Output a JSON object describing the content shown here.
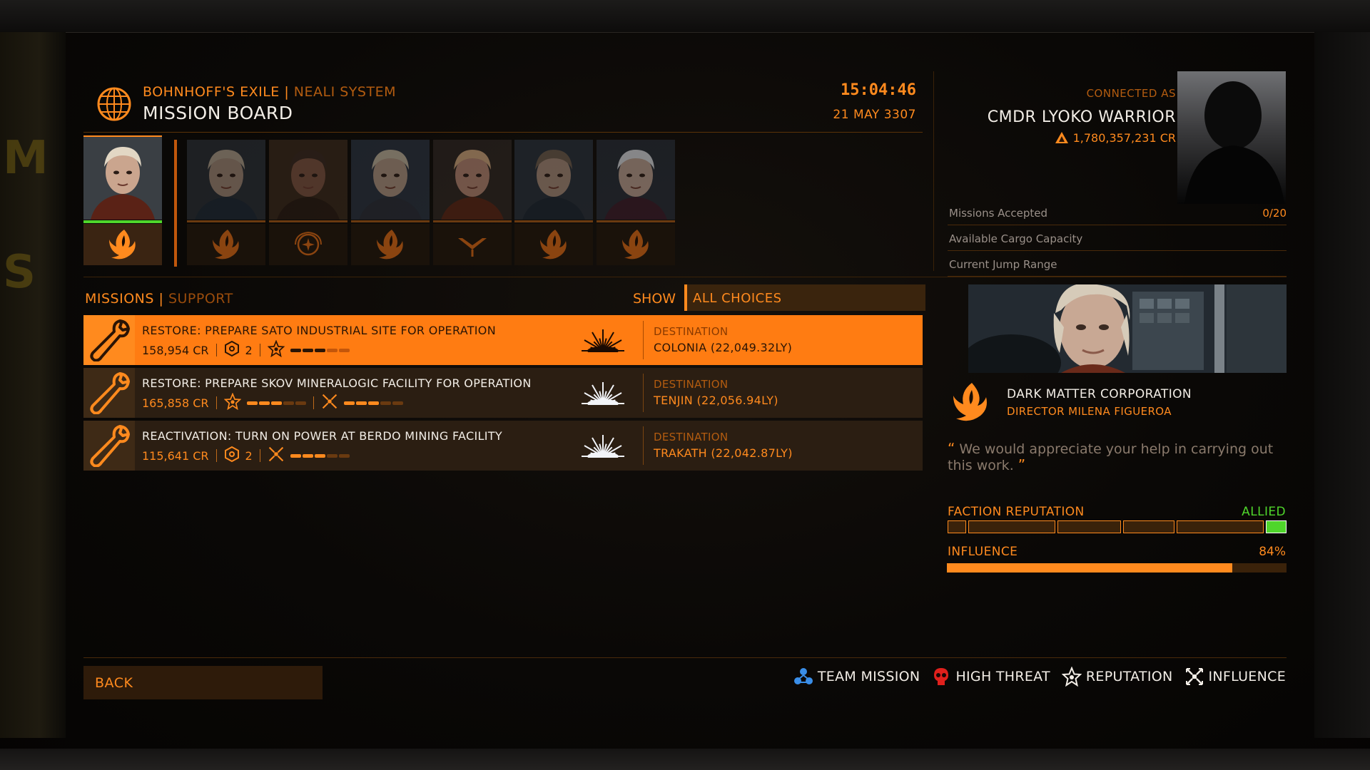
{
  "header": {
    "station": "BOHNHOFF'S EXILE",
    "divider": "|",
    "system": "NEALI SYSTEM",
    "title": "MISSION BOARD",
    "time": "15:04:46",
    "date": "21 MAY 3307"
  },
  "commander": {
    "connected_label": "CONNECTED AS",
    "name": "CMDR LYOKO WARRIOR",
    "credits": "1,780,357,231 CR",
    "stats": [
      {
        "label": "Missions Accepted",
        "value": "0/20"
      },
      {
        "label": "Available Cargo Capacity",
        "value": ""
      },
      {
        "label": "Current Jump Range",
        "value": ""
      }
    ]
  },
  "portraits": [
    {
      "emblem": "faction-wing-icon",
      "active": true
    },
    {
      "emblem": "faction-wing-icon"
    },
    {
      "emblem": "federation-icon"
    },
    {
      "emblem": "faction-wing-icon"
    },
    {
      "emblem": "alliance-icon"
    },
    {
      "emblem": "faction-wing-icon"
    },
    {
      "emblem": "faction-wing-icon"
    }
  ],
  "missions_header": {
    "tab_missions": "MISSIONS",
    "divider": "|",
    "tab_support": "SUPPORT",
    "show_label": "SHOW",
    "filter_value": "ALL CHOICES"
  },
  "missions": [
    {
      "title": "RESTORE: PREPARE SATO INDUSTRIAL SITE FOR OPERATION",
      "reward": "158,954 CR",
      "team_count": "2",
      "reputation_level": 3,
      "influence_level": 0,
      "destination_label": "DESTINATION",
      "destination": "COLONIA (22,049.32LY)",
      "selected": true
    },
    {
      "title": "RESTORE: PREPARE SKOV MINERALOGIC FACILITY FOR OPERATION",
      "reward": "165,858 CR",
      "team_count": "",
      "reputation_level": 3,
      "influence_level": 3,
      "destination_label": "DESTINATION",
      "destination": "TENJIN (22,056.94LY)",
      "selected": false
    },
    {
      "title": "REACTIVATION: TURN ON POWER AT BERDO MINING FACILITY",
      "reward": "115,641 CR",
      "team_count": "2",
      "reputation_level": 0,
      "influence_level": 3,
      "destination_label": "DESTINATION",
      "destination": "TRAKATH (22,042.87LY)",
      "selected": false
    }
  ],
  "contact": {
    "faction": "DARK MATTER CORPORATION",
    "director": "DIRECTOR MILENA FIGUEROA",
    "quote": "We would appreciate your help in carrying out this work.",
    "reputation_label": "FACTION REPUTATION",
    "reputation_value": "ALLIED",
    "reputation_level": 6,
    "influence_label": "INFLUENCE",
    "influence_value": "84%",
    "influence_fraction": 0.84
  },
  "footer": {
    "back_label": "BACK",
    "legend": [
      {
        "icon": "team-mission-icon",
        "label": "TEAM MISSION"
      },
      {
        "icon": "high-threat-icon",
        "label": "HIGH THREAT"
      },
      {
        "icon": "reputation-icon",
        "label": "REPUTATION"
      },
      {
        "icon": "influence-icon",
        "label": "INFLUENCE"
      }
    ]
  },
  "colors": {
    "accent": "#ff8a1e",
    "allied": "#4fd62b",
    "high_threat": "#e0201c",
    "team": "#3a8ee8"
  }
}
